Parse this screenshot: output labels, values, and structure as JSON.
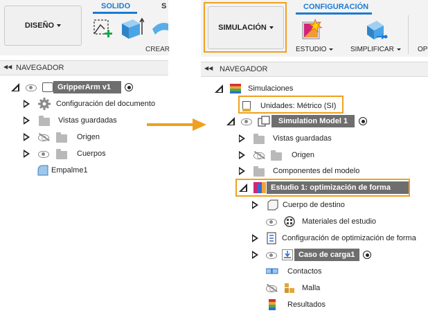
{
  "left_panel": {
    "workspace_button": "DISEÑO",
    "tab_active": "SOLIDO",
    "tab_partial": "S",
    "tool_partial_label": "CREAR",
    "navigator_label": "NAVEGADOR",
    "tree": {
      "root": "GripperArm v1",
      "items": [
        {
          "label": "Configuración del documento",
          "icon": "gear-icon"
        },
        {
          "label": "Vistas guardadas",
          "icon": "folder-icon"
        },
        {
          "label": "Origen",
          "icon": "folder-icon"
        },
        {
          "label": "Cuerpos",
          "icon": "folder-icon"
        },
        {
          "label": "Empalme1",
          "icon": "fillet-icon"
        }
      ]
    }
  },
  "right_panel": {
    "workspace_button": "SIMULACIÓN",
    "tab_active": "CONFIGURACIÓN",
    "tools": [
      {
        "label": "ESTUDIO",
        "icon": "study-icon"
      },
      {
        "label": "SIMPLIFICAR",
        "icon": "simplify-icon"
      },
      {
        "label": "OP",
        "icon": "partial-tool"
      }
    ],
    "navigator_label": "NAVEGADOR",
    "tree": {
      "root": "Simulaciones",
      "units": "Unidades: Métrico (SI)",
      "model": "Simulation Model 1",
      "model_items": [
        "Vistas guardadas",
        "Origen",
        "Componentes del modelo"
      ],
      "study": "Estudio 1: optimización de forma",
      "study_items": [
        {
          "label": "Cuerpo de destino"
        },
        {
          "label": "Materiales del estudio"
        },
        {
          "label": "Configuración de optimización de forma"
        },
        {
          "label": "Caso de carga1"
        },
        {
          "label": "Contactos"
        },
        {
          "label": "Malla"
        },
        {
          "label": "Resultados"
        }
      ]
    }
  },
  "colors": {
    "accent": "#1a7ad4",
    "highlight": "#f0a01e",
    "selected_bg": "#6e6e6e",
    "arrow": "#f0a01e"
  }
}
